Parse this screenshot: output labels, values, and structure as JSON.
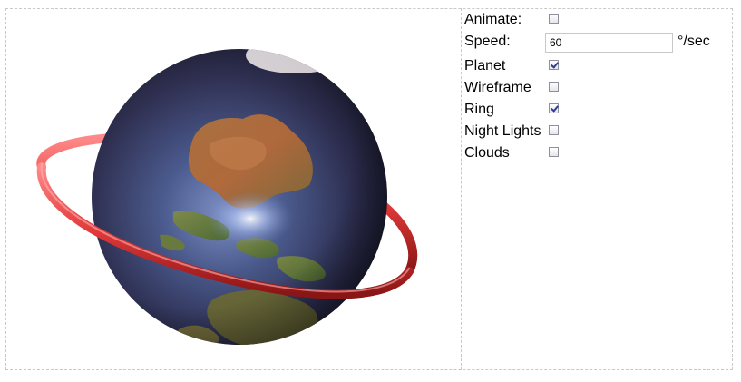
{
  "scene": {
    "planet_icon": "earth-globe",
    "ring_color": "#e23a3a",
    "ocean_color": "#3e4a78"
  },
  "controls": {
    "animate": {
      "label": "Animate:",
      "checked": false
    },
    "speed": {
      "label": "Speed:",
      "value": "60",
      "unit": "°/sec"
    },
    "planet": {
      "label": "Planet",
      "checked": true
    },
    "wireframe": {
      "label": "Wireframe",
      "checked": false
    },
    "ring": {
      "label": "Ring",
      "checked": true
    },
    "night_lights": {
      "label": "Night Lights",
      "checked": false
    },
    "clouds": {
      "label": "Clouds",
      "checked": false
    }
  }
}
